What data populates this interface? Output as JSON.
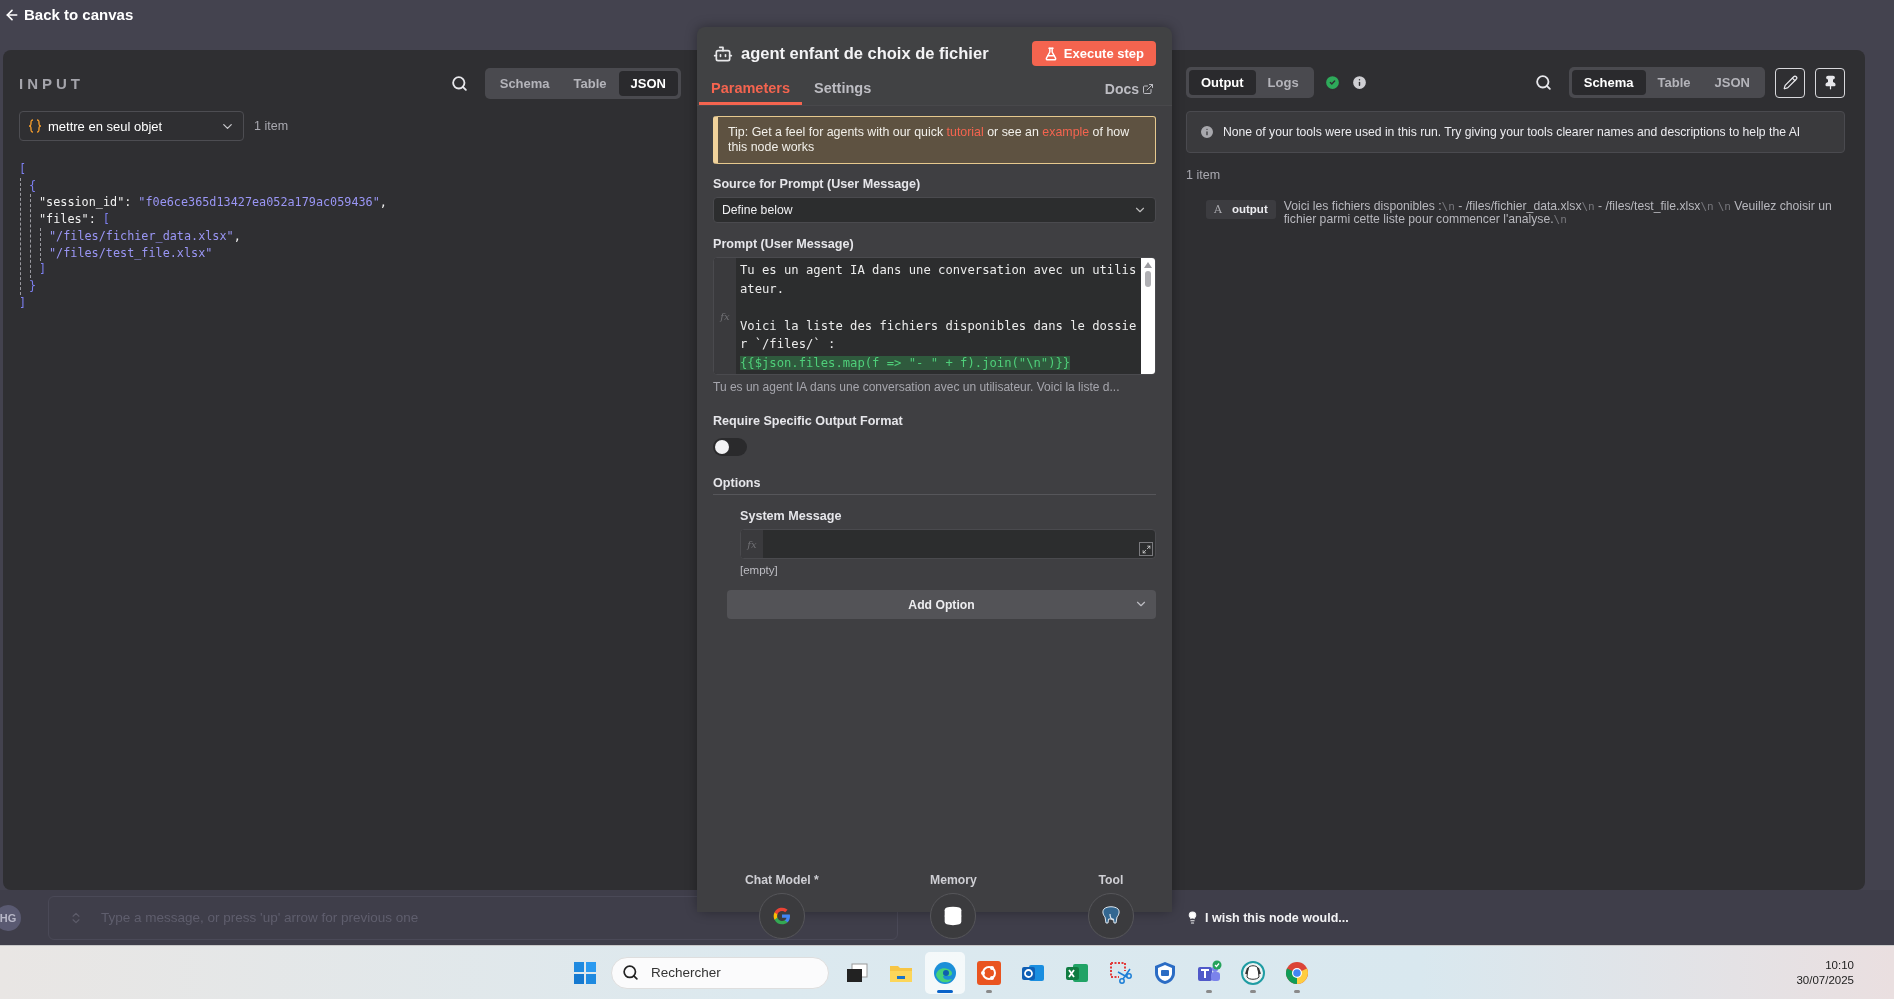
{
  "top_bar": {
    "back_label": "Back to canvas"
  },
  "input_panel": {
    "title": "INPUT",
    "view_tabs": [
      {
        "label": "Schema",
        "selected": false
      },
      {
        "label": "Table",
        "selected": false
      },
      {
        "label": "JSON",
        "selected": true
      }
    ],
    "source_node": "mettre en seul objet",
    "item_count": "1 item",
    "json_tree": {
      "open": "[",
      "close": "]",
      "children": [
        {
          "open": "{",
          "close": "}",
          "children": [
            {
              "key": "\"session_id\":",
              "value": "\"f0e6ce365d13427ea052a179ac059436\"",
              "suffix": ","
            },
            {
              "key": "\"files\":",
              "open": "[",
              "close": "]",
              "children": [
                {
                  "value": "\"/files/fichier_data.xlsx\"",
                  "suffix": ","
                },
                {
                  "value": "\"/files/test_file.xlsx\""
                }
              ]
            }
          ]
        }
      ]
    }
  },
  "node_panel": {
    "title": "agent enfant de choix de fichier",
    "execute_label": "Execute step",
    "tabs": [
      {
        "label": "Parameters",
        "selected": true
      },
      {
        "label": "Settings",
        "selected": false
      }
    ],
    "docs_label": "Docs",
    "tip": [
      {
        "kind": "text",
        "text": "Tip: Get a feel for agents with our quick "
      },
      {
        "kind": "link",
        "text": "tutorial"
      },
      {
        "kind": "text",
        "text": " or see an "
      },
      {
        "kind": "link",
        "text": "example"
      },
      {
        "kind": "text",
        "text": " of how this node works"
      }
    ],
    "source": {
      "label": "Source for Prompt (User Message)",
      "value": "Define below"
    },
    "prompt": {
      "label": "Prompt (User Message)",
      "fx_label": "fx",
      "paragraphs": [
        "Tu es un agent IA dans une conversation avec un utilisateur.",
        "Voici la liste des fichiers disponibles dans le dossier `/files/` :"
      ],
      "expression": "{{$json.files.map(f => \"- \" + f).join(\"\\n\")}}",
      "preview": "Tu es un agent IA dans une conversation avec un utilisateur. Voici la liste d..."
    },
    "output_format": {
      "label": "Require Specific Output Format",
      "on": false
    },
    "options": {
      "title": "Options",
      "system_message": {
        "label": "System Message",
        "fx_label": "fx",
        "hint": "[empty]"
      },
      "add_label": "Add Option"
    },
    "sub_nodes": [
      {
        "label": "Chat Model *",
        "kind": "google"
      },
      {
        "label": "Memory",
        "kind": "database"
      },
      {
        "label": "Tool",
        "kind": "postgres"
      }
    ]
  },
  "output_panel": {
    "mode_tabs": [
      {
        "label": "Output",
        "selected": true
      },
      {
        "label": "Logs",
        "selected": false
      }
    ],
    "success": true,
    "view_tabs": [
      {
        "label": "Schema",
        "selected": true
      },
      {
        "label": "Table",
        "selected": false
      },
      {
        "label": "JSON",
        "selected": false
      }
    ],
    "notice": "None of your tools were used in this run. Try giving your tools clearer names and descriptions to help the AI",
    "item_count": "1 item",
    "field": {
      "type_badge": "A",
      "name": "output",
      "value": [
        {
          "kind": "text",
          "text": "Voici les fichiers disponibles :"
        },
        {
          "kind": "escape",
          "text": "\\n"
        },
        {
          "kind": "text",
          "text": " - /files/fichier_data.xlsx"
        },
        {
          "kind": "escape",
          "text": "\\n"
        },
        {
          "kind": "text",
          "text": " - /files/test_file.xlsx"
        },
        {
          "kind": "escape",
          "text": "\\n"
        },
        {
          "kind": "escape",
          "text": "\\n"
        },
        {
          "kind": "text",
          "text": " Veuillez choisir un fichier parmi cette liste pour commencer l'analyse."
        },
        {
          "kind": "escape",
          "text": "\\n"
        }
      ]
    }
  },
  "chat": {
    "avatar": "HG",
    "placeholder": "Type a message, or press 'up' arrow for previous one"
  },
  "feedback": {
    "label": "I wish this node would..."
  },
  "taskbar": {
    "search_placeholder": "Rechercher",
    "apps": [
      {
        "kind": "taskview",
        "running": false,
        "selected": false
      },
      {
        "kind": "explorer",
        "running": false,
        "selected": false
      },
      {
        "kind": "edge",
        "running": true,
        "selected": true
      },
      {
        "kind": "ubuntu",
        "running": true,
        "selected": false
      },
      {
        "kind": "outlook",
        "running": false,
        "selected": false
      },
      {
        "kind": "excel",
        "running": false,
        "selected": false
      },
      {
        "kind": "snip",
        "running": false,
        "selected": false
      },
      {
        "kind": "shield",
        "running": false,
        "selected": false
      },
      {
        "kind": "teams",
        "running": true,
        "selected": false
      },
      {
        "kind": "dog",
        "running": true,
        "selected": false
      },
      {
        "kind": "chrome",
        "running": true,
        "selected": false
      }
    ],
    "time": "10:10",
    "date": "30/07/2025"
  }
}
